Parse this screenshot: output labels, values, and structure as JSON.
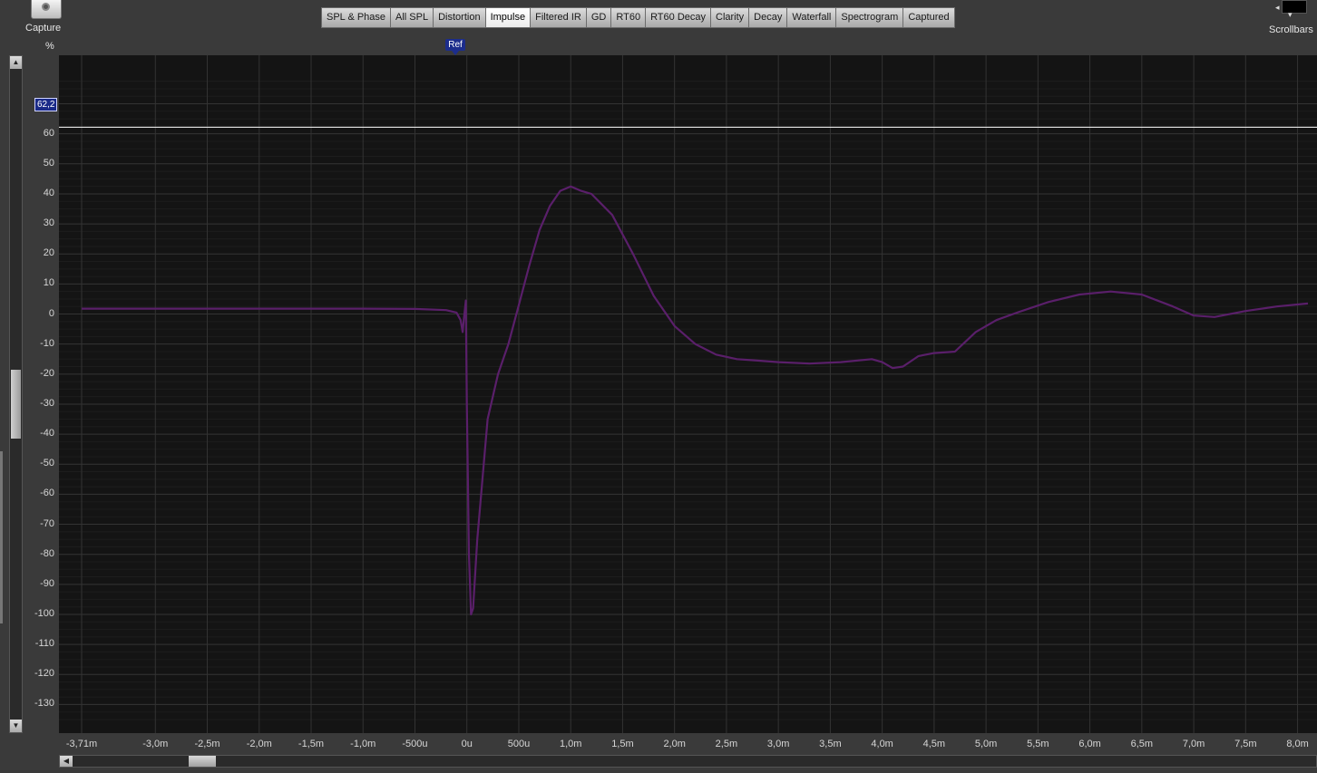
{
  "toolbar": {
    "capture_label": "Capture",
    "scrollbars_label": "Scrollbars",
    "unit_label": "%",
    "tabs": [
      {
        "label": "SPL & Phase",
        "active": false
      },
      {
        "label": "All SPL",
        "active": false
      },
      {
        "label": "Distortion",
        "active": false
      },
      {
        "label": "Impulse",
        "active": true
      },
      {
        "label": "Filtered IR",
        "active": false
      },
      {
        "label": "GD",
        "active": false
      },
      {
        "label": "RT60",
        "active": false
      },
      {
        "label": "RT60 Decay",
        "active": false
      },
      {
        "label": "Clarity",
        "active": false
      },
      {
        "label": "Decay",
        "active": false
      },
      {
        "label": "Waterfall",
        "active": false
      },
      {
        "label": "Spectrogram",
        "active": false
      },
      {
        "label": "Captured",
        "active": false
      }
    ]
  },
  "ref_marker_label": "Ref",
  "cursor_value": "62,2",
  "chart_data": {
    "type": "line",
    "title": "",
    "xlabel": "",
    "ylabel": "%",
    "xlim": [
      -3.71,
      8.1
    ],
    "ylim": [
      -135,
      78
    ],
    "grid": true,
    "colors": {
      "series": "#5a1f6a",
      "background": "#141414",
      "grid": "#2e2e2e",
      "cursor": "#ffffff"
    },
    "y_ticks": [
      70,
      60,
      50,
      40,
      30,
      20,
      10,
      0,
      -10,
      -20,
      -30,
      -40,
      -50,
      -60,
      -70,
      -80,
      -90,
      -100,
      -110,
      -120,
      -130
    ],
    "y_tick_labels": [
      "70",
      "60",
      "50",
      "40",
      "30",
      "20",
      "10",
      "0",
      "-10",
      "-20",
      "-30",
      "-40",
      "-50",
      "-60",
      "-70",
      "-80",
      "-90",
      "-100",
      "-110",
      "-120",
      "-130"
    ],
    "x_ticks": [
      -3.71,
      -3.0,
      -2.5,
      -2.0,
      -1.5,
      -1.0,
      -0.5,
      0,
      0.5,
      1.0,
      1.5,
      2.0,
      2.5,
      3.0,
      3.5,
      4.0,
      4.5,
      5.0,
      5.5,
      6.0,
      6.5,
      7.0,
      7.5,
      8.0
    ],
    "x_tick_labels": [
      "-3,71m",
      "-3,0m",
      "-2,5m",
      "-2,0m",
      "-1,5m",
      "-1,0m",
      "-500u",
      "0u",
      "500u",
      "1,0m",
      "1,5m",
      "2,0m",
      "2,5m",
      "3,0m",
      "3,5m",
      "4,0m",
      "4,5m",
      "5,0m",
      "5,5m",
      "6,0m",
      "6,5m",
      "7,0m",
      "7,5m",
      "8,0m"
    ],
    "cursor_y": 62.2,
    "series": [
      {
        "x": [
          -3.71,
          -3.0,
          -2.0,
          -1.0,
          -0.5,
          -0.2,
          -0.1,
          -0.06,
          -0.04,
          -0.03,
          -0.01,
          0.0,
          0.02,
          0.04,
          0.06,
          0.1,
          0.15,
          0.2,
          0.3,
          0.4,
          0.5,
          0.6,
          0.7,
          0.8,
          0.9,
          1.0,
          1.1,
          1.2,
          1.4,
          1.6,
          1.8,
          2.0,
          2.2,
          2.4,
          2.6,
          2.8,
          3.0,
          3.3,
          3.6,
          3.9,
          4.0,
          4.1,
          4.2,
          4.35,
          4.5,
          4.7,
          4.9,
          5.1,
          5.3,
          5.6,
          5.9,
          6.2,
          6.5,
          6.8,
          7.0,
          7.2,
          7.5,
          7.8,
          8.1
        ],
        "y": [
          1.8,
          1.8,
          1.8,
          1.8,
          1.7,
          1.3,
          0.5,
          -2.0,
          -6.0,
          -2.0,
          4.5,
          -30.0,
          -80.0,
          -100.0,
          -98.0,
          -75.0,
          -55.0,
          -35.0,
          -20.0,
          -10.0,
          3.0,
          16.0,
          28.0,
          36.0,
          41.0,
          42.5,
          41.0,
          40.0,
          33.0,
          20.0,
          6.0,
          -4.0,
          -10.0,
          -13.5,
          -15.0,
          -15.5,
          -16.0,
          -16.5,
          -16.0,
          -15.0,
          -16.0,
          -18.0,
          -17.5,
          -14.0,
          -13.0,
          -12.5,
          -6.0,
          -2.0,
          0.5,
          4.0,
          6.5,
          7.5,
          6.5,
          2.5,
          -0.5,
          -1.0,
          1.0,
          2.5,
          3.5
        ]
      }
    ]
  }
}
